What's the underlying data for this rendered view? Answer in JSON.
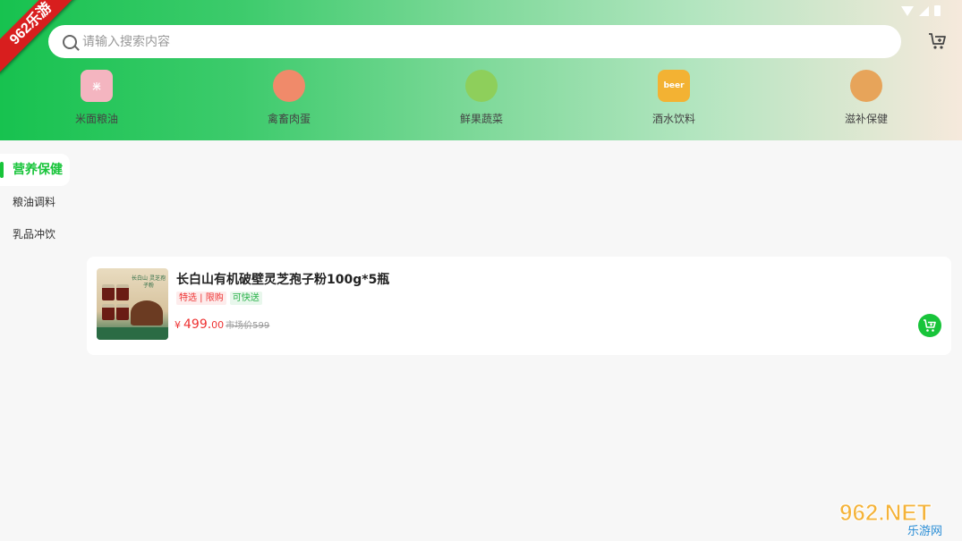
{
  "brand_ribbon": "962乐游",
  "search": {
    "placeholder": "请输入搜索内容"
  },
  "categories": [
    {
      "label": "米面粮油",
      "icon": "rice-bag-icon",
      "color": "#f4b5c0"
    },
    {
      "label": "禽畜肉蛋",
      "icon": "meat-icon",
      "color": "#f08a6a"
    },
    {
      "label": "鲜果蔬菜",
      "icon": "vegetable-icon",
      "color": "#8ecf5b"
    },
    {
      "label": "酒水饮料",
      "icon": "beer-icon",
      "color": "#f3b233"
    },
    {
      "label": "滋补保健",
      "icon": "ginseng-icon",
      "color": "#e7a45a"
    }
  ],
  "sidebar": {
    "items": [
      {
        "label": "营养保健",
        "active": true
      },
      {
        "label": "粮油调料",
        "active": false
      },
      {
        "label": "乳品冲饮",
        "active": false
      }
    ]
  },
  "product": {
    "title": "长白山有机破壁灵芝孢子粉100g*5瓶",
    "tag_featured": "特选 | 限购",
    "tag_express": "可快送",
    "currency": "¥",
    "price_int": "499.",
    "price_dec": "00",
    "market_price": "市场价599",
    "thumb_text": "长白山 灵芝孢子粉"
  },
  "watermark": {
    "main": "962.NET",
    "sub": "乐游网"
  },
  "colors": {
    "accent": "#18c43a",
    "price": "#e33333"
  }
}
